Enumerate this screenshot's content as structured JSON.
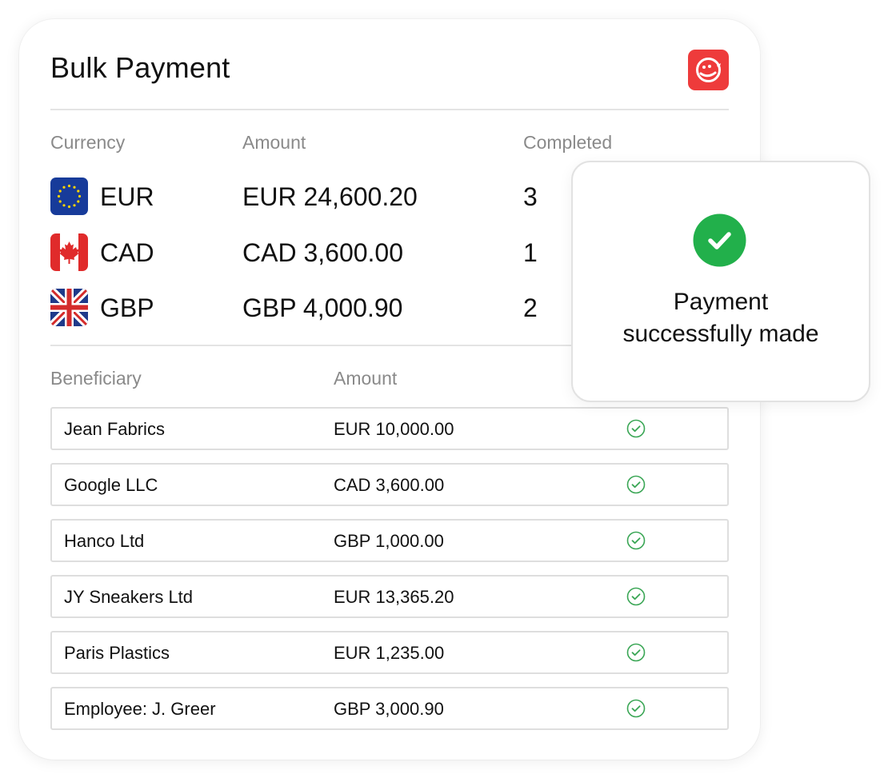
{
  "colors": {
    "accent_red": "#ee3b3b",
    "success_green": "#22b04b",
    "row_check_green": "#3aa655",
    "header_gray": "#8a8a8a",
    "border_gray": "#dedede"
  },
  "header": {
    "title": "Bulk Payment",
    "logo_icon": "brand-logo-icon"
  },
  "currency_table": {
    "columns": [
      "Currency",
      "Amount",
      "Completed"
    ],
    "rows": [
      {
        "flag": "eu-flag-icon",
        "code": "EUR",
        "amount": "EUR 24,600.20",
        "completed": "3"
      },
      {
        "flag": "canada-flag-icon",
        "code": "CAD",
        "amount": "CAD 3,600.00",
        "completed": "1"
      },
      {
        "flag": "uk-flag-icon",
        "code": "GBP",
        "amount": "GBP 4,000.90",
        "completed": "2"
      }
    ]
  },
  "beneficiary_table": {
    "columns": [
      "Beneficiary",
      "Amount"
    ],
    "rows": [
      {
        "name": "Jean Fabrics",
        "amount": "EUR 10,000.00",
        "status_icon": "check-circle-icon"
      },
      {
        "name": "Google LLC",
        "amount": "CAD 3,600.00",
        "status_icon": "check-circle-icon"
      },
      {
        "name": "Hanco Ltd",
        "amount": "GBP 1,000.00",
        "status_icon": "check-circle-icon"
      },
      {
        "name": "JY Sneakers Ltd",
        "amount": "EUR 13,365.20",
        "status_icon": "check-circle-icon"
      },
      {
        "name": "Paris Plastics",
        "amount": "EUR 1,235.00",
        "status_icon": "check-circle-icon"
      },
      {
        "name": "Employee: J. Greer",
        "amount": "GBP 3,000.90",
        "status_icon": "check-circle-icon"
      }
    ]
  },
  "toast": {
    "icon": "success-check-icon",
    "line1": "Payment",
    "line2": "successfully made"
  }
}
